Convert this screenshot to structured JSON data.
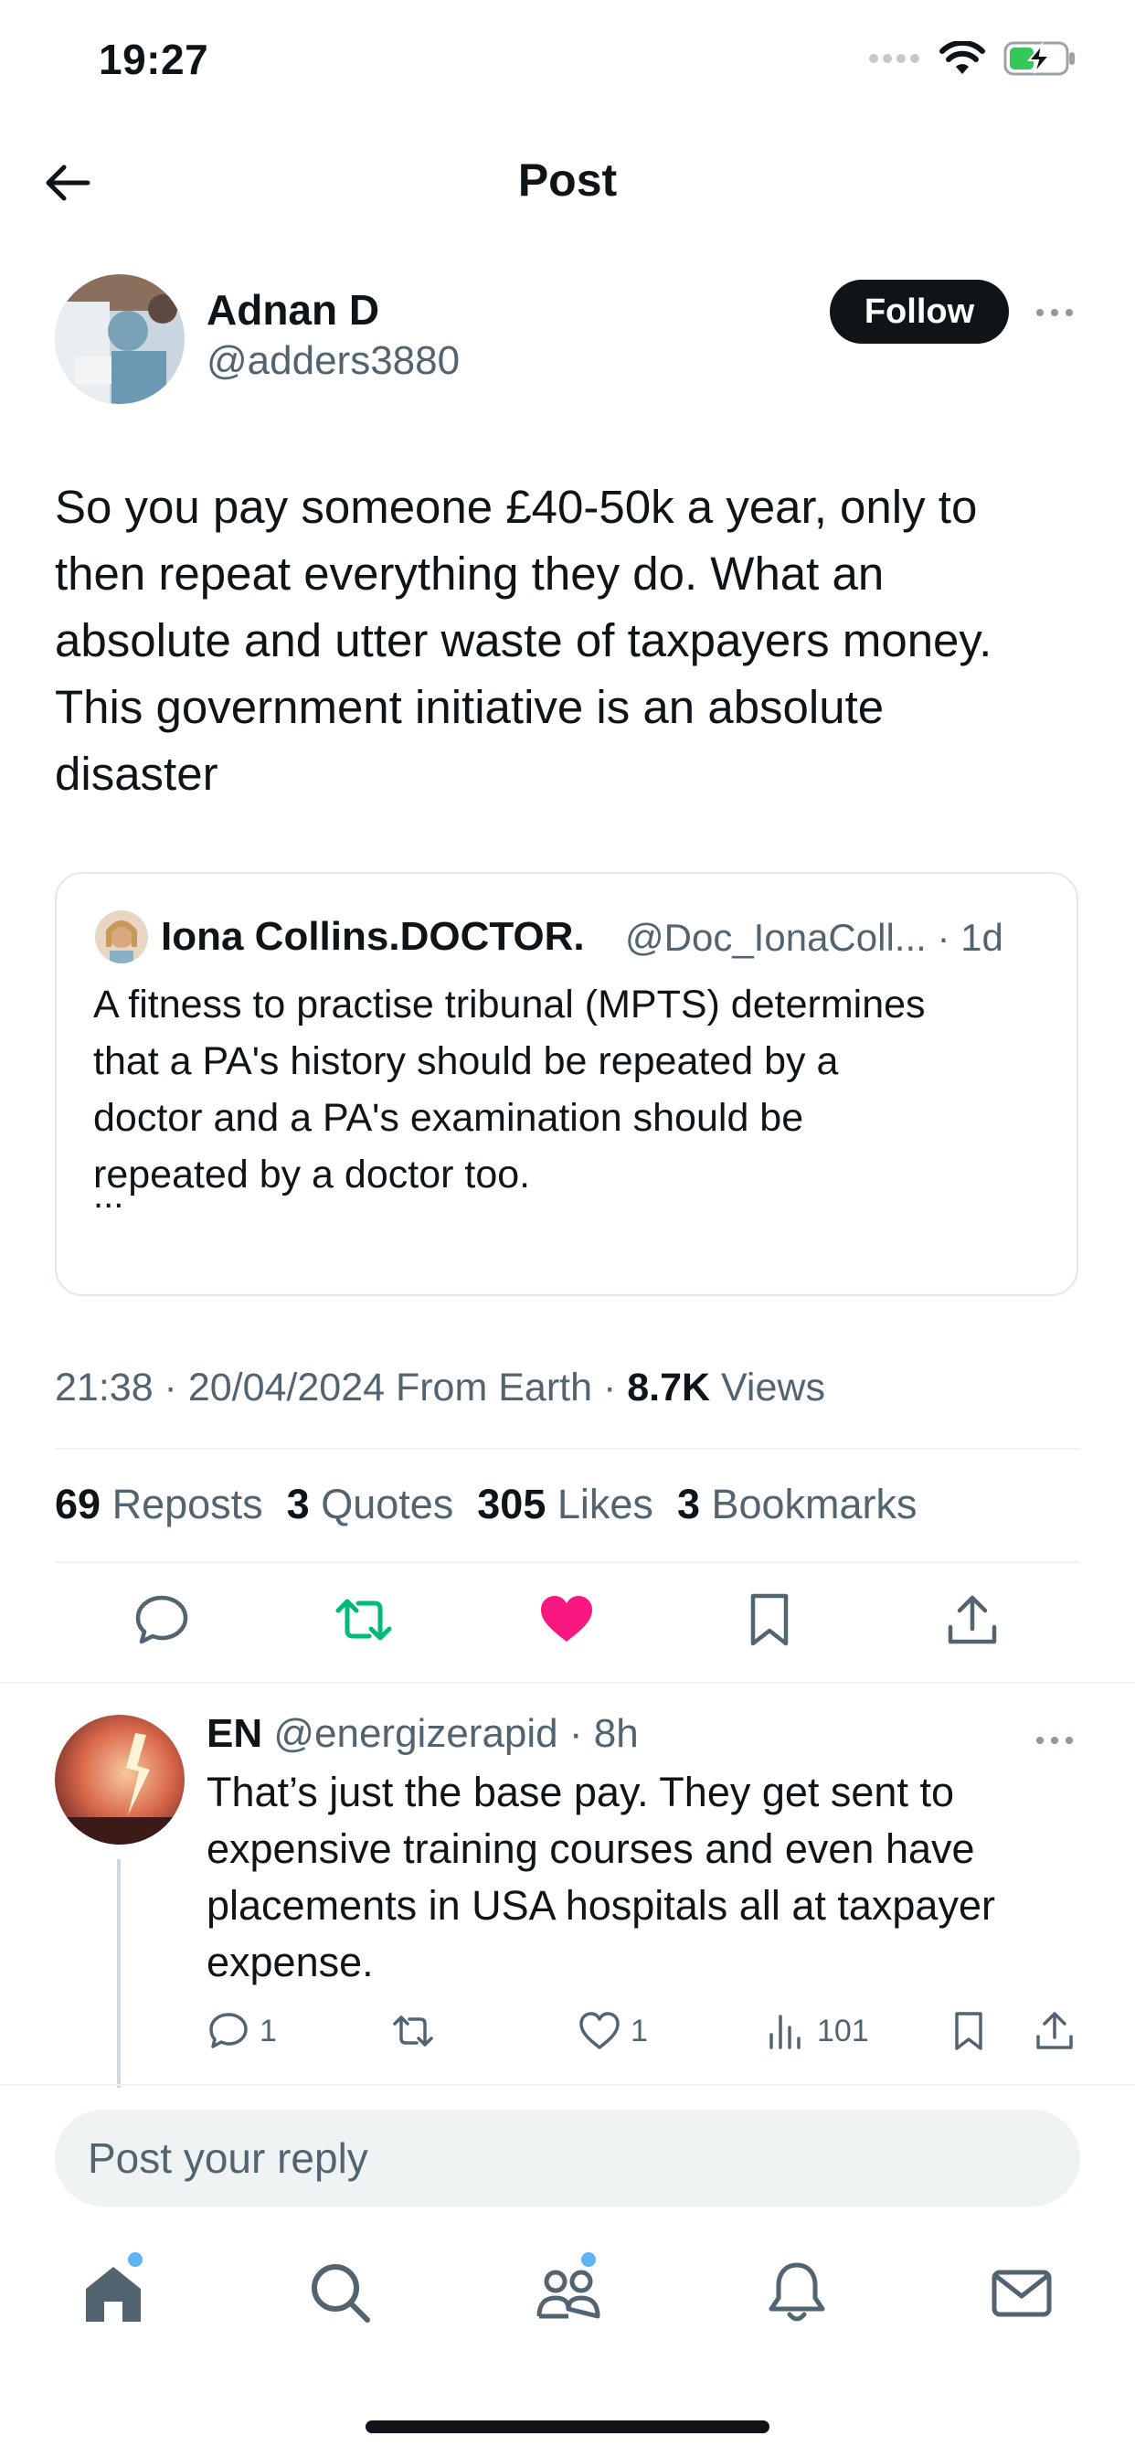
{
  "status_bar": {
    "time": "19:27"
  },
  "header": {
    "title": "Post"
  },
  "post": {
    "author_name": "Adnan D",
    "author_handle": "@adders3880",
    "follow_label": "Follow",
    "text_lines": [
      "So you pay someone £40-50k a year, only to",
      "then repeat everything they do. What an",
      "absolute and utter waste of taxpayers money.",
      "This government initiative is an absolute",
      "disaster"
    ],
    "quote": {
      "name": "Iona Collins.DOCTOR.",
      "handle_time": "@Doc_IonaColl... · 1d",
      "text_lines": [
        "A fitness to practise tribunal (MPTS) determines",
        "that a PA's history should be repeated by a",
        "doctor and a PA's examination should be",
        "repeated by a doctor too."
      ],
      "ellipsis": "..."
    },
    "meta": {
      "time_date": "21:38 · 20/04/2024 From Earth · ",
      "views_count": "8.7K",
      "views_label": " Views"
    },
    "stats": {
      "reposts_count": "69",
      "reposts_label": " Reposts",
      "quotes_count": "3",
      "quotes_label": " Quotes",
      "likes_count": "305",
      "likes_label": " Likes",
      "bookmarks_count": "3",
      "bookmarks_label": " Bookmarks"
    }
  },
  "reply": {
    "name": "EN",
    "handle_time": " @energizerapid · 8h",
    "text_lines": [
      "That’s just the base pay. They get sent to",
      "expensive training courses and even have",
      "placements in USA hospitals all at taxpayer",
      "expense."
    ],
    "replies": "1",
    "likes": "1",
    "views": "101"
  },
  "reply_box": {
    "placeholder": "Post your reply"
  },
  "colors": {
    "accent_like": "#f91880",
    "accent_repost": "#00ba7c",
    "text_secondary": "#536471",
    "badge_dot": "#5fb3f0"
  },
  "icons": [
    "back-arrow-icon",
    "wifi-icon",
    "battery-charging-icon",
    "more-icon",
    "reply-icon",
    "repost-icon",
    "like-icon",
    "bookmark-icon",
    "share-icon",
    "views-icon",
    "home-icon",
    "search-icon",
    "communities-icon",
    "notifications-icon",
    "messages-icon"
  ]
}
